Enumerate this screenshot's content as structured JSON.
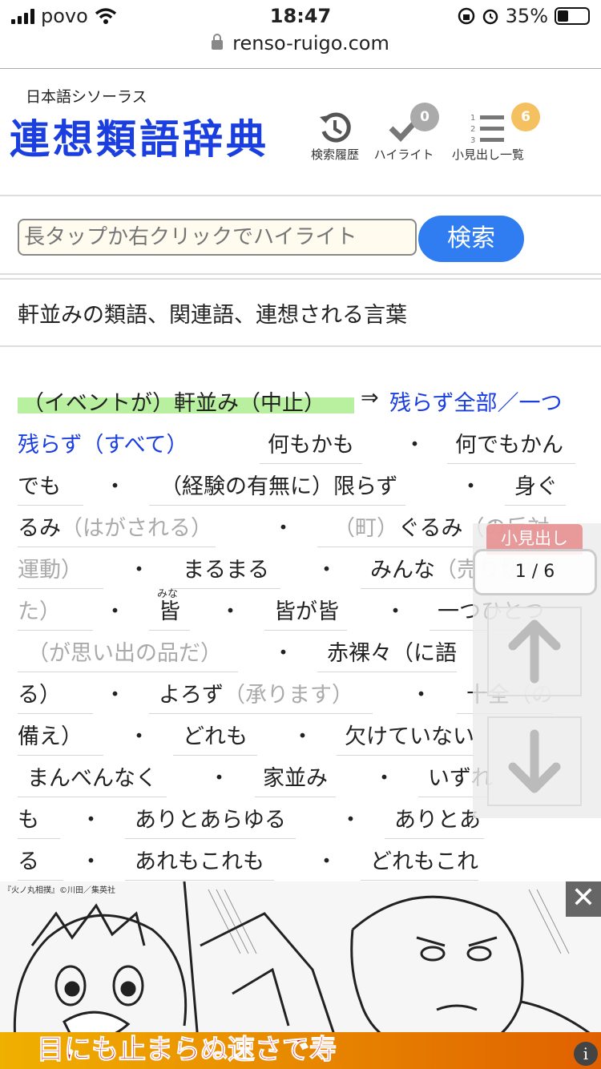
{
  "status": {
    "carrier": "povo",
    "time": "18:47",
    "battery": "35%",
    "battery_level": 0.35
  },
  "browser": {
    "url": "renso-ruigo.com"
  },
  "header": {
    "subtitle": "日本語シソーラス",
    "logo": "連想類語辞典",
    "history_label": "検索履歴",
    "highlight_label": "ハイライト",
    "highlight_count": "0",
    "index_label": "小見出し一覧",
    "index_count": "6"
  },
  "search": {
    "placeholder": "長タップか右クリックでハイライト",
    "button": "検索"
  },
  "page_heading": "軒並みの類語、関連語、連想される言葉",
  "entry": {
    "headword_parts": [
      "（イベントが）軒並み（中止）",
      "⇒"
    ],
    "link": [
      "残らず全部／一つ",
      "残らず（すべて）"
    ],
    "dot": "・",
    "words": {
      "w1": "何もかも",
      "w2": "何でもかん",
      "w2b": "でも",
      "w3": "（経験の有無に）限らず",
      "w4a": "身ぐ",
      "w4b": "るみ",
      "w4g": "（はがされる）",
      "w5g1": "（町）",
      "w5": "ぐるみ",
      "w5g2": "（の反対",
      "w5g3": "運動）",
      "w6": "まるまる",
      "w7": "みんな",
      "w7g": "（売り切れ",
      "w7g2": "た）",
      "w8": "皆",
      "w8r": "みな",
      "w9": "皆が皆",
      "w10": "一つひとつ",
      "w10g": "（が思い出の品だ）",
      "w11": "赤裸々（に語",
      "w11b": "る）",
      "w12": "よろず",
      "w12g": "（承ります）",
      "w13": "十全",
      "w13g": "（の",
      "w13b": "備え）",
      "w14": "どれも",
      "w15": "欠けていない",
      "w16": "まんべんなく",
      "w17": "家並み",
      "w18": "いずれ",
      "w18b": "も",
      "w19": "ありとあらゆる",
      "w20": "ありとあ",
      "w20b": "る",
      "w21": "あれもこれも",
      "w22": "どれもこれ"
    }
  },
  "float_nav": {
    "label": "小見出し",
    "counter": "1 / 6"
  },
  "ad": {
    "credit": "『火ノ丸相撲』©川田／集英社",
    "caption": "目にも止まらぬ速さで寿",
    "close": "✕",
    "info": "i"
  }
}
